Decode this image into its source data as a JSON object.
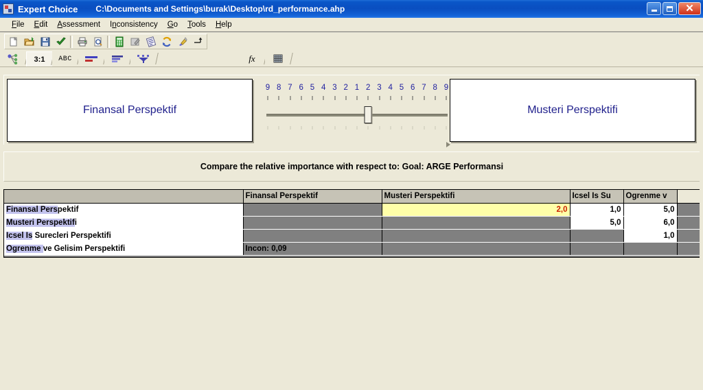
{
  "window": {
    "app_name": "Expert Choice",
    "document_path": "C:\\Documents and Settings\\burak\\Desktop\\rd_performance.ahp",
    "app_icon": "expert-choice-icon",
    "buttons": {
      "minimize": "minimize-icon",
      "maximize": "maximize-icon",
      "close": "close-icon"
    },
    "colors": {
      "titlebar_start": "#1f6fd8",
      "titlebar_end": "#0a4ec0",
      "close_button": "#d03018",
      "face": "#ece9d8",
      "workspace": "#808080",
      "node_text": "#20208c",
      "active_cell_bg": "#ffffa8",
      "active_cell_text": "#cc2200",
      "highlight": "#c3c3ee"
    }
  },
  "menubar": {
    "items": [
      {
        "label": "File",
        "accel": "F"
      },
      {
        "label": "Edit",
        "accel": "E"
      },
      {
        "label": "Assessment",
        "accel": "A"
      },
      {
        "label": "Inconsistency",
        "accel": "n"
      },
      {
        "label": "Go",
        "accel": "G"
      },
      {
        "label": "Tools",
        "accel": "T"
      },
      {
        "label": "Help",
        "accel": "H"
      }
    ]
  },
  "toolbar": {
    "buttons": [
      {
        "name": "new-icon",
        "glyph": "⎕",
        "tip": "New"
      },
      {
        "name": "open-folder-icon",
        "glyph": "📂",
        "tip": "Open"
      },
      {
        "name": "save-icon",
        "glyph": "💾",
        "tip": "Save"
      },
      {
        "name": "check-icon",
        "glyph": "✔",
        "tip": "Apply"
      },
      {
        "name": "print-icon",
        "glyph": "⎙",
        "tip": "Print"
      },
      {
        "name": "print-preview-icon",
        "glyph": "🔍",
        "tip": "Print Preview"
      },
      {
        "name": "calculator-icon",
        "glyph": "▦",
        "tip": "Calculator"
      },
      {
        "name": "notes-icon",
        "glyph": "✎",
        "tip": "Notes"
      },
      {
        "name": "sensitivity-icon",
        "glyph": "◱",
        "tip": "Sensitivity"
      },
      {
        "name": "synthesize-icon",
        "glyph": "↻",
        "tip": "Synthesize"
      },
      {
        "name": "highlighter-icon",
        "glyph": "✏",
        "tip": "Highlight"
      },
      {
        "name": "goto-icon",
        "glyph": "→",
        "tip": "Go To"
      }
    ]
  },
  "tabstrip": {
    "tabs": [
      {
        "name": "tab-tree-view",
        "label": "",
        "icon": "tree-node-icon",
        "active": false
      },
      {
        "name": "tab-ratio",
        "label": "3:1",
        "icon": "",
        "active": true
      },
      {
        "name": "tab-verbal",
        "label": "ABC",
        "icon": "",
        "active": false
      },
      {
        "name": "tab-graphical",
        "label": "",
        "icon": "bar-compare-icon",
        "active": false
      },
      {
        "name": "tab-pairwise",
        "label": "",
        "icon": "bars-icon",
        "active": false
      },
      {
        "name": "tab-distribute",
        "label": "",
        "icon": "funnel-icon",
        "active": false
      },
      {
        "name": "tab-formula",
        "label": "fx",
        "icon": "",
        "active": false
      },
      {
        "name": "tab-grid",
        "label": "",
        "icon": "grid-icon",
        "active": false
      }
    ]
  },
  "comparison": {
    "left_node": "Finansal Perspektif",
    "right_node": "Musteri Perspektifi",
    "instruction": "Compare the relative importance with respect to: Goal: ARGE Performansi",
    "slider": {
      "labels": [
        "9",
        "8",
        "7",
        "6",
        "5",
        "4",
        "3",
        "2",
        "1",
        "2",
        "3",
        "4",
        "5",
        "6",
        "7",
        "8",
        "9"
      ],
      "thumb_index": 9,
      "thumb_value": "2",
      "favored_side": "right"
    }
  },
  "matrix": {
    "columns": [
      "",
      "Finansal Perspektif",
      "Musteri Perspektifi",
      "Icsel Is Su",
      "Ogrenme v",
      ""
    ],
    "rows": [
      {
        "label": "Finansal Perspektif",
        "highlight_chars": 13,
        "cells": [
          {
            "type": "filled",
            "value": ""
          },
          {
            "type": "value",
            "value": "2,0",
            "active": true
          },
          {
            "type": "value",
            "value": "1,0",
            "active": false
          },
          {
            "type": "value",
            "value": "5,0",
            "active": false
          },
          {
            "type": "tail",
            "value": ""
          }
        ]
      },
      {
        "label": "Musteri Perspektifi",
        "highlight_chars": 18,
        "cells": [
          {
            "type": "filled",
            "value": ""
          },
          {
            "type": "filled",
            "value": ""
          },
          {
            "type": "value",
            "value": "5,0",
            "active": false
          },
          {
            "type": "value",
            "value": "6,0",
            "active": false
          },
          {
            "type": "tail",
            "value": ""
          }
        ]
      },
      {
        "label": "Icsel Is Surecleri Perspektifi",
        "highlight_chars": 8,
        "cells": [
          {
            "type": "filled",
            "value": ""
          },
          {
            "type": "filled",
            "value": ""
          },
          {
            "type": "filled",
            "value": ""
          },
          {
            "type": "value",
            "value": "1,0",
            "active": false
          },
          {
            "type": "tail",
            "value": ""
          }
        ]
      },
      {
        "label": "Ogrenme ve Gelisim Perspektifi",
        "highlight_chars": 8,
        "cells": [
          {
            "type": "incon",
            "value": "Incon: 0,09"
          },
          {
            "type": "filled",
            "value": ""
          },
          {
            "type": "filled",
            "value": ""
          },
          {
            "type": "filled",
            "value": ""
          },
          {
            "type": "tail",
            "value": ""
          }
        ]
      }
    ],
    "inconsistency": "Incon: 0,09"
  }
}
